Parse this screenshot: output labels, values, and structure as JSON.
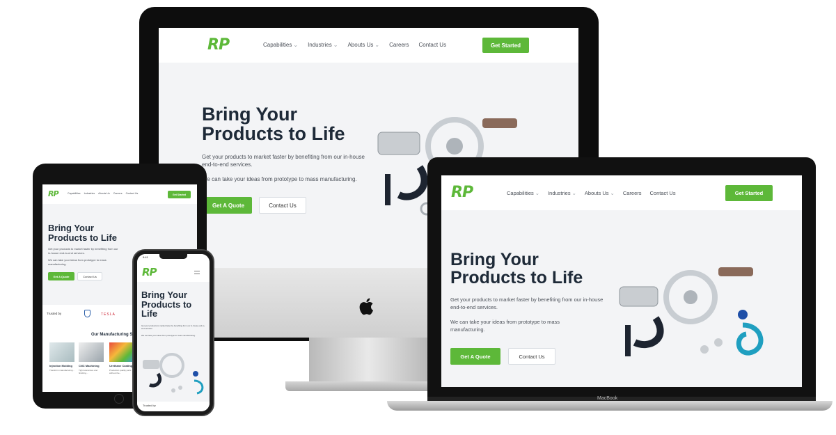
{
  "brand": {
    "logo_text": "RP",
    "accent": "#5db839",
    "dark_text": "#1e2a38",
    "hero_bg": "#f3f4f6"
  },
  "nav": {
    "items": [
      {
        "label": "Capabilities",
        "dropdown": true
      },
      {
        "label": "Industries",
        "dropdown": true
      },
      {
        "label": "Abouts Us",
        "dropdown": true
      },
      {
        "label": "Careers",
        "dropdown": false
      },
      {
        "label": "Contact Us",
        "dropdown": false
      }
    ],
    "cta_label": "Get Started"
  },
  "hero": {
    "title_line1": "Bring Your",
    "title_line2": "Products to Life",
    "phone_title_line1": "Bring Your",
    "phone_title_line2": "Products to",
    "phone_title_line3": "Life",
    "paragraph1": "Get your products to market faster by benefiting from our in-house end-to-end services.",
    "paragraph2": "We can take your ideas from prototype to mass manufacturing.",
    "quote_button": "Get A Quote",
    "contact_button": "Contact Us"
  },
  "trusted_by": {
    "label": "Trusted by",
    "brands": [
      "TESLA"
    ]
  },
  "manufacturing": {
    "heading": "Our Manufacturing S",
    "services": [
      {
        "title": "Injection Molding",
        "desc": "Transform manufacturing..."
      },
      {
        "title": "CNC Machining",
        "desc": "Tight tolerances and finishing..."
      },
      {
        "title": "Urethane Casting",
        "desc": "Production quality parts without the..."
      }
    ]
  },
  "devices": {
    "laptop_label": "MacBook",
    "phone_status_time": "9:41"
  },
  "icons": {
    "apple_logo": "apple-icon",
    "chevron": "chevron-down-icon",
    "menu": "hamburger-icon"
  }
}
